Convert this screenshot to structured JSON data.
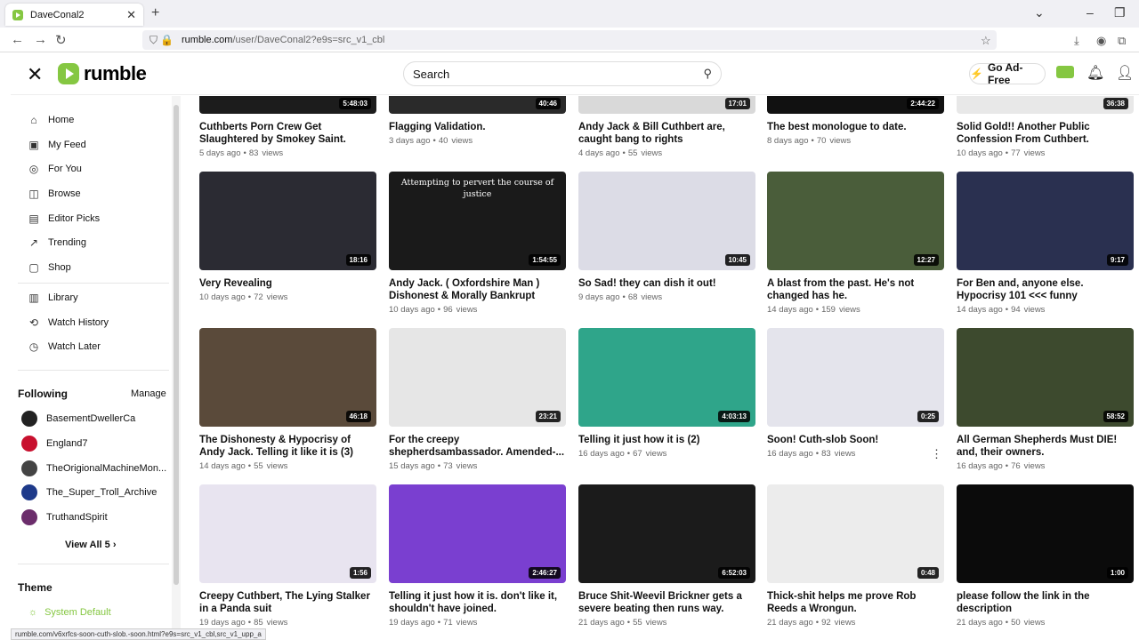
{
  "browser": {
    "tab_title": "DaveConal2",
    "url_host": "rumble.com",
    "url_path": "/user/DaveConal2?e9s=src_v1_cbl",
    "status_url": "rumble.com/v6xrfcs-soon-cuth-slob.-soon.html?e9s=src_v1_cbl,src_v1_upp_a"
  },
  "header": {
    "logo_text": "rumble",
    "search_placeholder": "Search",
    "ad_free_label": "Go Ad-Free"
  },
  "sidebar": {
    "nav": [
      {
        "label": "Home",
        "icon": "home-icon"
      },
      {
        "label": "My Feed",
        "icon": "feed-icon"
      },
      {
        "label": "For You",
        "icon": "for-you-icon"
      },
      {
        "label": "Browse",
        "icon": "browse-icon"
      },
      {
        "label": "Editor Picks",
        "icon": "editor-picks-icon"
      },
      {
        "label": "Trending",
        "icon": "trending-icon"
      },
      {
        "label": "Shop",
        "icon": "shop-icon"
      }
    ],
    "library": [
      {
        "label": "Library",
        "icon": "library-icon"
      },
      {
        "label": "Watch History",
        "icon": "history-icon"
      },
      {
        "label": "Watch Later",
        "icon": "clock-icon"
      }
    ],
    "following_title": "Following",
    "manage_label": "Manage",
    "following": [
      {
        "name": "BasementDwellerCa",
        "color": "#222222"
      },
      {
        "name": "England7",
        "color": "#c8102e"
      },
      {
        "name": "TheOrigionalMachineMon...",
        "color": "#444444"
      },
      {
        "name": "The_Super_Troll_Archive",
        "color": "#1e3a8a"
      },
      {
        "name": "TruthandSpirit",
        "color": "#6b2d6b"
      }
    ],
    "view_all_label": "View All 5",
    "theme_title": "Theme",
    "theme_value": "System Default"
  },
  "videos_top": [
    {
      "duration": "5:48:03",
      "title": "Cuthberts Porn Crew Get Slaughtered by Smokey Saint.",
      "age": "5 days ago",
      "views": "83",
      "views_label": "views",
      "bg": "#1c1c1c"
    },
    {
      "duration": "40:46",
      "title": "Flagging Validation.",
      "age": "3 days ago",
      "views": "40",
      "views_label": "views",
      "bg": "#2a2a2a"
    },
    {
      "duration": "17:01",
      "title": "Andy Jack & Bill Cuthbert are, caught bang to rights",
      "age": "4 days ago",
      "views": "55",
      "views_label": "views",
      "bg": "#d9d9d9"
    },
    {
      "duration": "2:44:22",
      "title": "The best monologue to date.",
      "age": "8 days ago",
      "views": "70",
      "views_label": "views",
      "bg": "#111111"
    },
    {
      "duration": "36:38",
      "title": "Solid Gold!! Another Public Confession From Cuthbert.",
      "age": "10 days ago",
      "views": "77",
      "views_label": "views",
      "bg": "#e8e8e8"
    }
  ],
  "videos_row2": [
    {
      "duration": "18:16",
      "title": "Very Revealing",
      "age": "10 days ago",
      "views": "72",
      "views_label": "views",
      "bg": "#2b2b33",
      "overlay": ""
    },
    {
      "duration": "1:54:55",
      "title": "Andy Jack. ( Oxfordshire Man ) Dishonest & Morally Bankrupt",
      "age": "10 days ago",
      "views": "96",
      "views_label": "views",
      "bg": "#1a1a1a",
      "overlay": "Attempting to pervert the course of justice"
    },
    {
      "duration": "10:45",
      "title": "So Sad! they can dish it out!",
      "age": "9 days ago",
      "views": "68",
      "views_label": "views",
      "bg": "#dcdce6",
      "overlay": ""
    },
    {
      "duration": "12:27",
      "title": "A blast from the past. He's not changed has he.",
      "age": "14 days ago",
      "views": "159",
      "views_label": "views",
      "bg": "#4a5d3a",
      "overlay": ""
    },
    {
      "duration": "9:17",
      "title": "For Ben and, anyone else. Hypocrisy 101 <<< funny",
      "age": "14 days ago",
      "views": "94",
      "views_label": "views",
      "bg": "#2a3050",
      "overlay": ""
    }
  ],
  "videos_row3": [
    {
      "duration": "46:18",
      "title": "The Dishonesty & Hypocrisy of Andy Jack. Telling it like it is (3)",
      "age": "14 days ago",
      "views": "55",
      "views_label": "views",
      "bg": "#5a4a3a"
    },
    {
      "duration": "23:21",
      "title": "For the creepy shepherdsambassador. Amended-...",
      "age": "15 days ago",
      "views": "73",
      "views_label": "views",
      "bg": "#e6e6e6"
    },
    {
      "duration": "4:03:13",
      "title": "Telling it just how it is (2)",
      "age": "16 days ago",
      "views": "67",
      "views_label": "views",
      "bg": "#2fa58a"
    },
    {
      "duration": "0:25",
      "title": "Soon! Cuth-slob Soon!",
      "age": "16 days ago",
      "views": "83",
      "views_label": "views",
      "bg": "#e4e4ec"
    },
    {
      "duration": "58:52",
      "title": "All German Shepherds Must DIE! and, their owners.",
      "age": "16 days ago",
      "views": "76",
      "views_label": "views",
      "bg": "#3d4a2e"
    }
  ],
  "videos_row4": [
    {
      "duration": "1:56",
      "title": "Creepy Cuthbert, The Lying Stalker in a Panda suit",
      "age": "19 days ago",
      "views": "85",
      "views_label": "views",
      "bg": "#e8e4f0"
    },
    {
      "duration": "2:46:27",
      "title": "Telling it just how it is. don't like it, shouldn't have joined.",
      "age": "19 days ago",
      "views": "71",
      "views_label": "views",
      "bg": "#7a3fd0"
    },
    {
      "duration": "6:52:03",
      "title": "Bruce Shit-Weevil Brickner gets a severe beating then runs way.",
      "age": "21 days ago",
      "views": "55",
      "views_label": "views",
      "bg": "#1b1b1b"
    },
    {
      "duration": "0:48",
      "title": "Thick-shit helps me prove Rob Reeds a Wrongun.",
      "age": "21 days ago",
      "views": "92",
      "views_label": "views",
      "bg": "#ececec"
    },
    {
      "duration": "1:00",
      "title": "please follow the link in the description",
      "age": "21 days ago",
      "views": "50",
      "views_label": "views",
      "bg": "#0b0b0b"
    }
  ]
}
